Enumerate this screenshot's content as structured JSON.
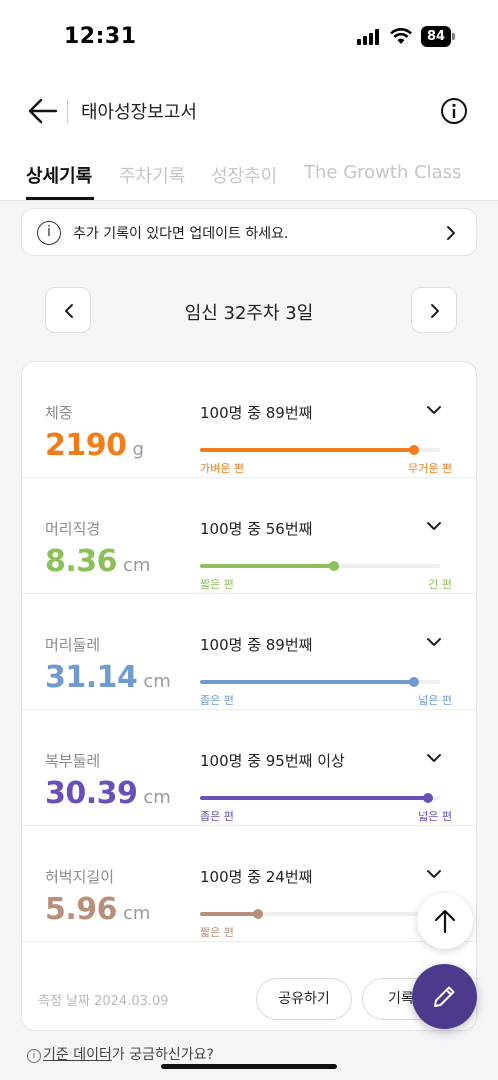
{
  "status_bar": {
    "time": "12:31",
    "battery": "84"
  },
  "header": {
    "title": "태아성장보고서",
    "back_icon": "arrow-left-icon",
    "info_icon": "info-circle-icon"
  },
  "tabs": [
    {
      "label": "상세기록",
      "active": true
    },
    {
      "label": "주차기록",
      "active": false
    },
    {
      "label": "성장추이",
      "active": false
    },
    {
      "label": "The Growth Class",
      "active": false
    }
  ],
  "notice": {
    "icon": "info-icon",
    "icon_glyph": "i",
    "text": "추가 기록이 있다면 업데이트 하세요."
  },
  "week": {
    "label": "임신 32주차 3일"
  },
  "metrics": [
    {
      "label": "체중",
      "value": "2190",
      "unit": "g",
      "rank": "100명 중 89번째",
      "percentile": 0.89,
      "color": "#f07d1a",
      "low_label": "가벼운 편",
      "high_label": "무거운 편"
    },
    {
      "label": "머리직경",
      "value": "8.36",
      "unit": "cm",
      "rank": "100명 중 56번째",
      "percentile": 0.56,
      "color": "#8cc05a",
      "low_label": "짧은 편",
      "high_label": "긴 편"
    },
    {
      "label": "머리둘레",
      "value": "31.14",
      "unit": "cm",
      "rank": "100명 중 89번째",
      "percentile": 0.89,
      "color": "#6f9bd1",
      "low_label": "좁은 편",
      "high_label": "넓은 편"
    },
    {
      "label": "복부둘레",
      "value": "30.39",
      "unit": "cm",
      "rank": "100명 중 95번째 이상",
      "percentile": 0.95,
      "color": "#6a4fb8",
      "low_label": "좁은 편",
      "high_label": "넓은 편"
    },
    {
      "label": "허벅지길이",
      "value": "5.96",
      "unit": "cm",
      "rank": "100명 중 24번째",
      "percentile": 0.24,
      "color": "#b8907a",
      "low_label": "짧은 편",
      "high_label": ""
    }
  ],
  "footer": {
    "measure_date": "측정 날짜 2024.03.09",
    "share_label": "공유하기",
    "record_label": "기록"
  },
  "bottom_link": {
    "icon_glyph": "i",
    "link_text": "기준 데이터",
    "suffix": "가 궁금하신가요?"
  }
}
